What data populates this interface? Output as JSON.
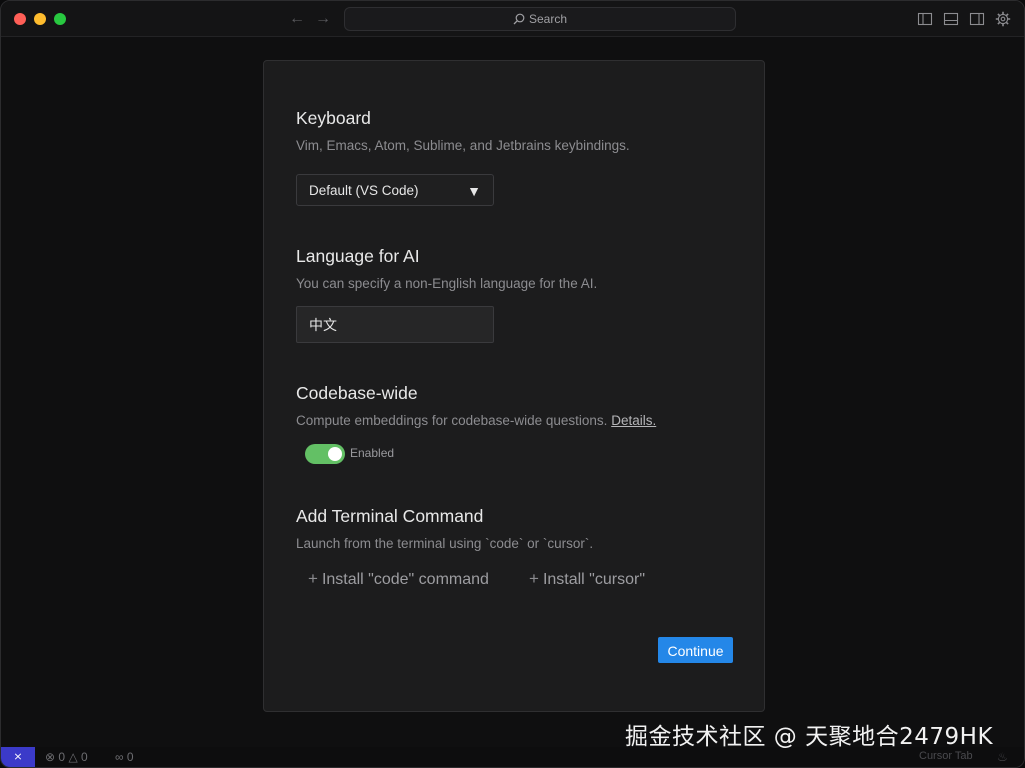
{
  "titlebar": {
    "search_label": "Search",
    "colors": {
      "close": "#ff5f57",
      "minimize": "#febc2e",
      "maximize": "#28c840"
    }
  },
  "dialog": {
    "keyboard": {
      "title": "Keyboard",
      "description": "Vim, Emacs, Atom, Sublime, and Jetbrains keybindings.",
      "selected": "Default (VS Code)"
    },
    "language": {
      "title": "Language for AI",
      "description": "You can specify a non-English language for the AI.",
      "value": "中文"
    },
    "codebase": {
      "title": "Codebase-wide",
      "description": "Compute embeddings for codebase-wide questions.",
      "details_link": "Details.",
      "toggle_label": "Enabled",
      "toggle_on": true,
      "toggle_color": "#63c065"
    },
    "terminal": {
      "title": "Add Terminal Command",
      "description": "Launch from the terminal using `code` or `cursor`.",
      "install_code": "Install \"code\" command",
      "install_cursor": "Install \"cursor\""
    },
    "continue_label": "Continue",
    "continue_color": "#2487e8"
  },
  "statusbar": {
    "errors": "0",
    "warnings": "0",
    "ports": "0",
    "right_text": "Cursor Tab"
  },
  "watermark": "掘金技术社区 @ 天聚地合2479HK"
}
